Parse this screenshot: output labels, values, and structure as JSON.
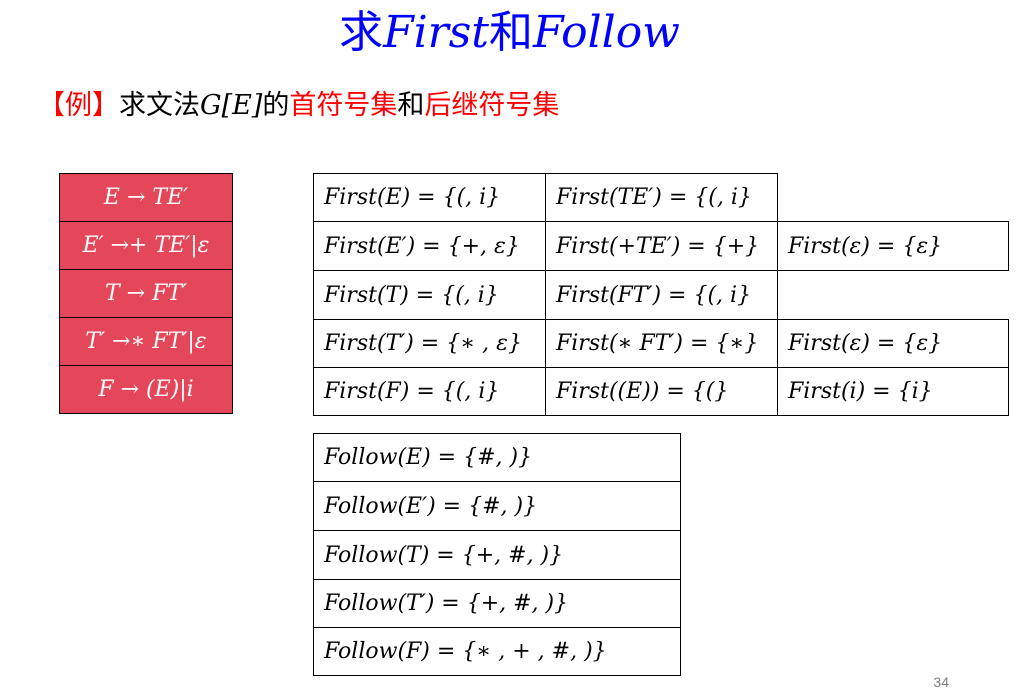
{
  "title": {
    "part1": "求",
    "part2": "First",
    "part3": "和",
    "part4": "Follow"
  },
  "subtitle": {
    "bracket": "【例】",
    "text1": "求文法",
    "math": "G[E]",
    "text2": "的",
    "red1": "首符号集",
    "text3": "和",
    "red2": "后继符号集"
  },
  "grammar": [
    "E → TE′",
    "E′ →+ TE′|ε",
    "T → FT′",
    "T′ →∗ FT′|ε",
    "F → (E)|i"
  ],
  "first_sets": {
    "r1c1": "First(E) = {(, i}",
    "r1c2": "First(TE′) = {(, i}",
    "r2c1": "First(E′) = {+, ε}",
    "r2c2": "First(+TE′) = {+}",
    "r2c3": "First(ε) = {ε}",
    "r3c1": "First(T) = {(, i}",
    "r3c2": "First(FT′) = {(, i}",
    "r4c1": "First(T′) = {∗ , ε}",
    "r4c2": "First(∗ FT′) = {∗}",
    "r4c3": "First(ε) = {ε}",
    "r5c1": "First(F) = {(, i}",
    "r5c2": "First((E)) = {(}",
    "r5c3": "First(i) = {i}"
  },
  "follow_sets": [
    "Follow(E) = {#, )}",
    "Follow(E′) = {#, )}",
    "Follow(T) = {+, #, )}",
    "Follow(T′) = {+, #, )}",
    "Follow(F) = {∗ , + , #, )}"
  ],
  "page_number": "34",
  "colors": {
    "title": "#0000ff",
    "highlight": "#ff0000",
    "grammar_bg": "#e5475a",
    "page_number": "#7f7f7f"
  }
}
